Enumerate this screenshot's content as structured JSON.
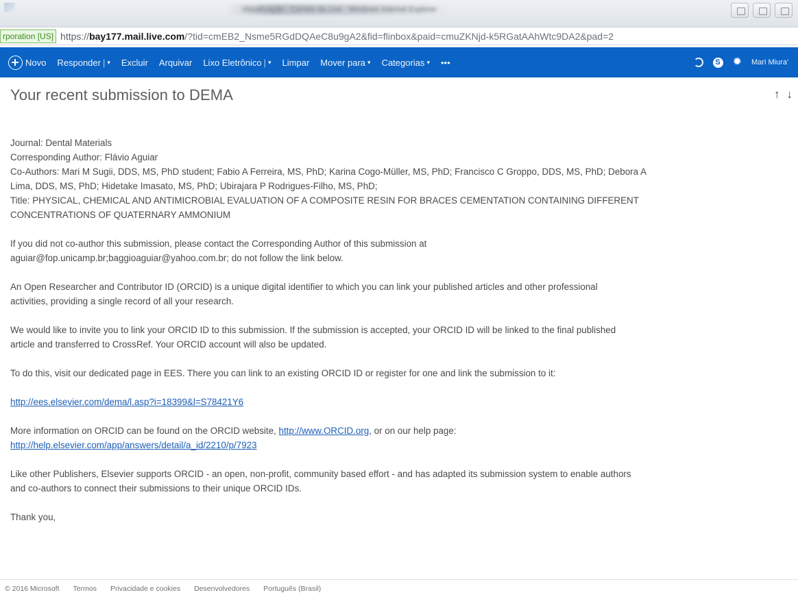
{
  "browser": {
    "window_title": "Visualização - Correio da Live - Windows Internet Explorer",
    "cert_label": "rporation [US]",
    "url_scheme": "https://",
    "url_host": "bay177.mail.live.com",
    "url_path": "/?tid=cmEB2_Nsme5RGdDQAeC8u9gA2&fid=flinbox&paid=cmuZKNjd-k5RGatAAhWtc9DA2&pad=2"
  },
  "toolbar": {
    "new_label": "Novo",
    "reply_label": "Responder",
    "delete_label": "Excluir",
    "archive_label": "Arquivar",
    "junk_label": "Lixo Eletrônico",
    "sweep_label": "Limpar",
    "move_label": "Mover para",
    "categories_label": "Categorias",
    "more_label": "•••",
    "user_name": "Mari Miura'"
  },
  "message": {
    "subject": "Your recent submission to DEMA",
    "lines": [
      "Journal: Dental Materials",
      "Corresponding Author: Flávio Aguiar",
      "Co-Authors: Mari M Sugii, DDS, MS, PhD student; Fabio A Ferreira, MS, PhD; Karina Cogo-Müller, MS, PhD; Francisco C Groppo, DDS, MS, PhD; Debora A",
      "Lima, DDS, MS, PhD; Hidetake Imasato, MS, PhD; Ubirajara P Rodrigues-Filho, MS, PhD;",
      "Title: PHYSICAL, CHEMICAL AND ANTIMICROBIAL EVALUATION OF A COMPOSITE RESIN FOR BRACES CEMENTATION CONTAINING DIFFERENT",
      "CONCENTRATIONS OF QUATERNARY AMMONIUM"
    ],
    "contact_line1": "If you did not co-author this submission, please contact the Corresponding Author of this submission at",
    "contact_line2": "aguiar@fop.unicamp.br;baggioaguiar@yahoo.com.br; do not follow the link below.",
    "orcid_line1": "An Open Researcher and Contributor ID (ORCID) is a unique digital identifier to which you can link your published articles and other professional",
    "orcid_line2": "activities, providing a single record of all your research.",
    "invite_line1": "We would like to invite you to link your ORCID ID to this submission. If the submission is accepted, your ORCID ID will be linked to the final published",
    "invite_line2": "article and transferred to CrossRef. Your ORCID account will also be updated.",
    "visit_line": "To do this, visit our dedicated page in EES. There you can link to an existing ORCID ID or register for one and link the submission to it:",
    "ees_link": "http://ees.elsevier.com/dema/l.asp?i=18399&l=S78421Y6",
    "more_info_prefix": "More information on ORCID can be found on the ORCID website, ",
    "orcid_site_link": "http://www.ORCID.org",
    "more_info_suffix": ", or on our help page:",
    "help_link": "http://help.elsevier.com/app/answers/detail/a_id/2210/p/7923",
    "publisher_line1": "Like other Publishers, Elsevier supports ORCID - an open, non-profit, community based effort - and has adapted its submission system to enable authors",
    "publisher_line2": "and co-authors to connect their submissions to their unique ORCID IDs.",
    "thanks": "Thank you,"
  },
  "footer": {
    "copyright": "© 2016 Microsoft",
    "terms": "Termos",
    "privacy": "Privacidade e cookies",
    "developers": "Desenvolvedores",
    "language": "Português (Brasil)"
  }
}
